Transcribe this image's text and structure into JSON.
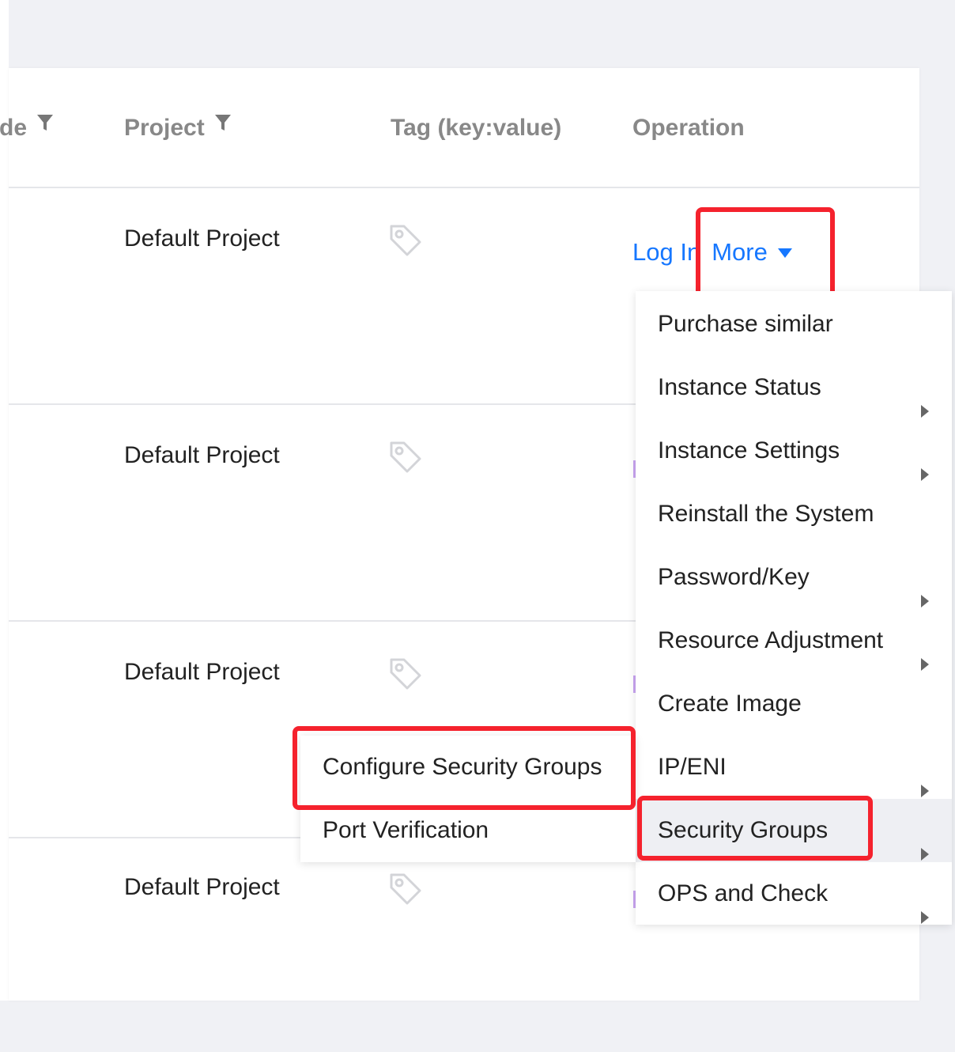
{
  "table": {
    "columns": [
      {
        "label": "de",
        "filter": true
      },
      {
        "label": "Project",
        "filter": true
      },
      {
        "label": "Tag (key:value)",
        "filter": false
      },
      {
        "label": "Operation",
        "filter": false
      }
    ],
    "rows": [
      {
        "project": "Default Project",
        "tag_icon": "tag-icon"
      },
      {
        "project": "Default Project",
        "tag_icon": "tag-icon"
      },
      {
        "project": "Default Project",
        "tag_icon": "tag-icon"
      },
      {
        "project": "Default Project",
        "tag_icon": "tag-icon"
      }
    ],
    "operation": {
      "login_label": "Log In",
      "more_label": "More"
    }
  },
  "more_menu": {
    "items": [
      {
        "label": "Purchase similar",
        "submenu": false
      },
      {
        "label": "Instance Status",
        "submenu": true
      },
      {
        "label": "Instance Settings",
        "submenu": true
      },
      {
        "label": "Reinstall the System",
        "submenu": false
      },
      {
        "label": "Password/Key",
        "submenu": true
      },
      {
        "label": "Resource Adjustment",
        "submenu": true
      },
      {
        "label": "Create Image",
        "submenu": false
      },
      {
        "label": "IP/ENI",
        "submenu": true
      },
      {
        "label": "Security Groups",
        "submenu": true,
        "active": true
      },
      {
        "label": "OPS and Check",
        "submenu": true
      }
    ]
  },
  "security_submenu": {
    "items": [
      {
        "label": "Configure Security Groups"
      },
      {
        "label": "Port Verification"
      }
    ]
  },
  "colors": {
    "link": "#1677ff",
    "highlight": "#f5222d",
    "header_text": "#888888"
  }
}
